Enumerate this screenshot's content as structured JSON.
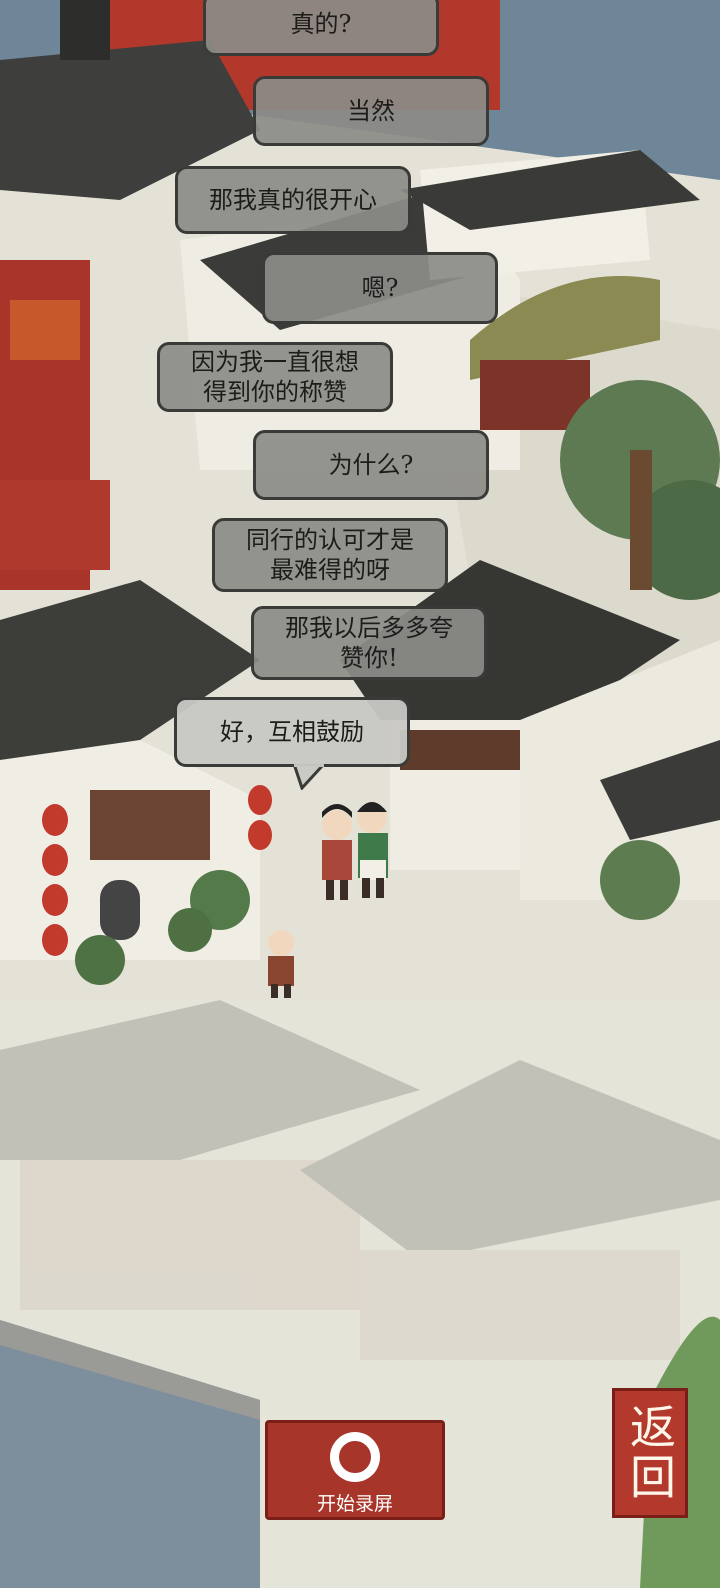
{
  "dialogue": [
    {
      "text": "真的?"
    },
    {
      "text": "当然"
    },
    {
      "text": "那我真的很开心"
    },
    {
      "text": "嗯?"
    },
    {
      "text": "因为我一直很想\n得到你的称赞"
    },
    {
      "text": "为什么?"
    },
    {
      "text": "同行的认可才是\n最难得的呀"
    },
    {
      "text": "那我以后多多夸\n赞你!"
    },
    {
      "text": "好，互相鼓励"
    }
  ],
  "controls": {
    "record_label": "开始录屏",
    "back_label": "返回"
  },
  "colors": {
    "accent_red": "#a8352a",
    "bubble_gray": "#8c8c88",
    "water": "#6f8598"
  },
  "icons": {
    "record": "record-icon"
  }
}
